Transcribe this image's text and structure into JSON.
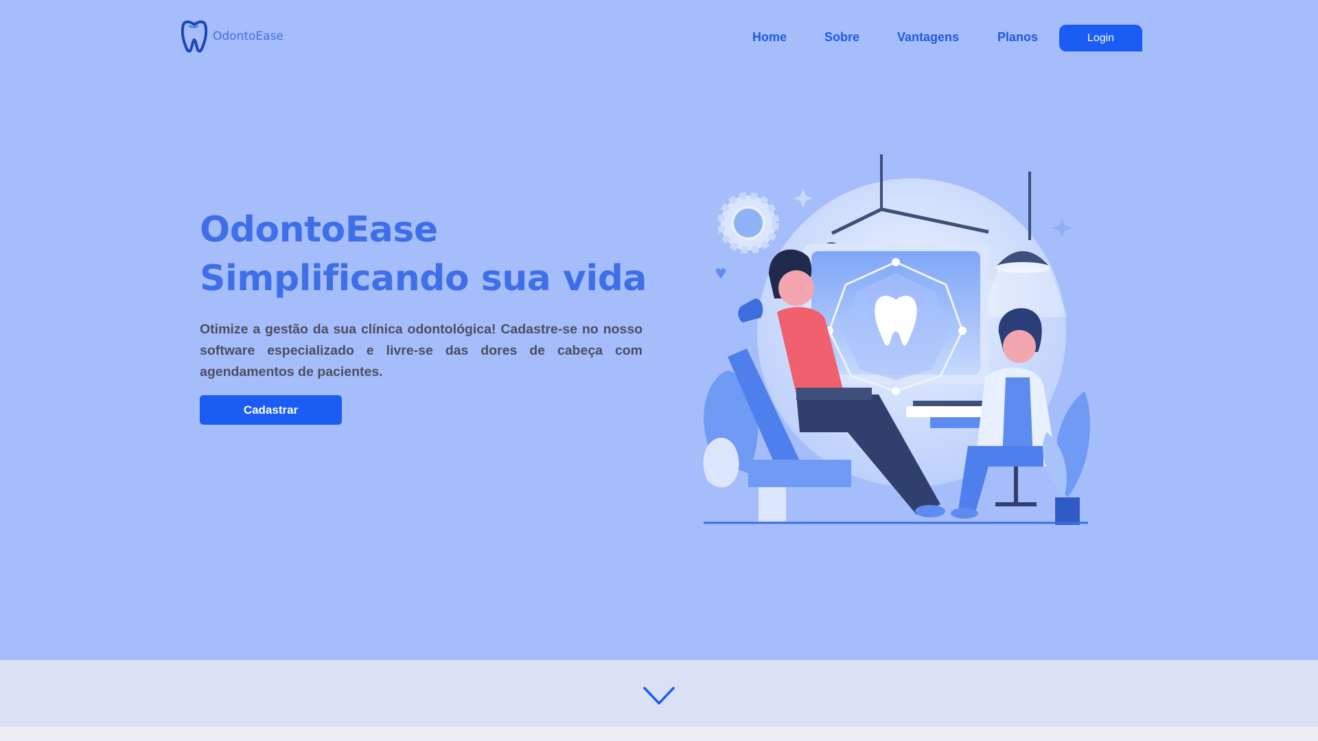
{
  "brand": {
    "name": "OdontoEase",
    "logo_icon": "tooth-logo-icon"
  },
  "nav": {
    "home": "Home",
    "sobre": "Sobre",
    "vantagens": "Vantagens",
    "planos": "Planos",
    "login": "Login"
  },
  "hero": {
    "title_line1": "OdontoEase",
    "title_line2": "Simplificando sua vida",
    "description": "Otimize a gestão da sua clínica odontológica! Cadastre-se no nosso software especializado e livre-se das dores de cabeça com agendamentos de pacientes.",
    "cta": "Cadastrar",
    "illustration": "dental-clinic-illustration"
  },
  "footer_band": {
    "icon": "chevron-down-icon"
  },
  "colors": {
    "hero_bg": "#a6bdfb",
    "primary": "#1a5cf4",
    "title": "#3f6fe8",
    "nav_text": "#1f5ae0",
    "body_text": "#4a4e60",
    "band_bg": "#dbe0f4"
  }
}
